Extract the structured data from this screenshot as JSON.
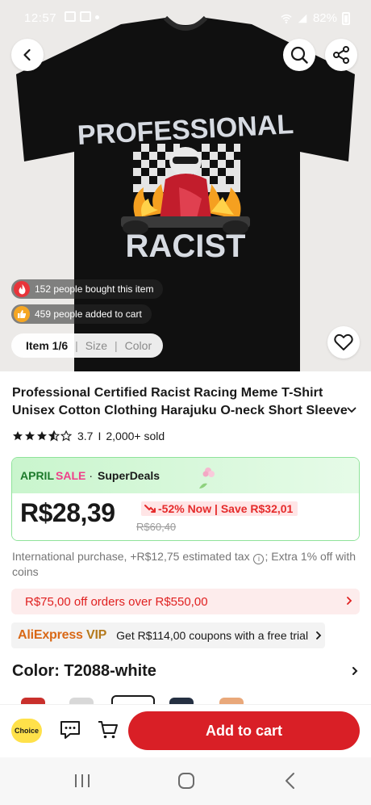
{
  "status_bar": {
    "time": "12:57",
    "battery": "82%"
  },
  "hero": {
    "print_top_text": "PROFESSIONAL",
    "print_bottom_text": "RACIST",
    "social_proof": [
      {
        "text": "152 people bought this item",
        "icon": "flame-icon",
        "color": "#e8343a"
      },
      {
        "text": "459 people added to cart",
        "icon": "thumbs-up-icon",
        "color": "#f5a623"
      }
    ],
    "tabs": [
      {
        "label": "Item 1/6",
        "active": true
      },
      {
        "label": "Size",
        "active": false
      },
      {
        "label": "Color",
        "active": false
      }
    ]
  },
  "product": {
    "title": "Professional Certified Racist Racing Meme T-Shirt Unisex Cotton Clothing Harajuku O-neck Short Sleeve Women's",
    "rating": "3.7",
    "rating_fraction": 0.74,
    "sold": "2,000+ sold"
  },
  "deal": {
    "brand_april": "APRIL",
    "brand_sale": "SALE",
    "dot": "·",
    "superdeals": "SuperDeals",
    "price": "R$28,39",
    "discount": "-52% Now | Save R$32,01",
    "old_price": "R$60,40",
    "accent": "#e52b2b",
    "border": "#8fe39a"
  },
  "info": {
    "tax_before": "International purchase, +R$12,75 estimated tax",
    "tax_after": "; Extra 1% off with coins",
    "coupon": "R$75,00 off orders over R$550,00",
    "vip_logo_main": "AliExpress",
    "vip_logo_vip": "VIP",
    "vip_text": "Get R$114,00 coupons with a free trial"
  },
  "variant": {
    "color_label": "Color: T2088-white"
  },
  "action_bar": {
    "choice": "Choice",
    "add_to_cart": "Add to cart",
    "brand_red": "#d91f26"
  }
}
